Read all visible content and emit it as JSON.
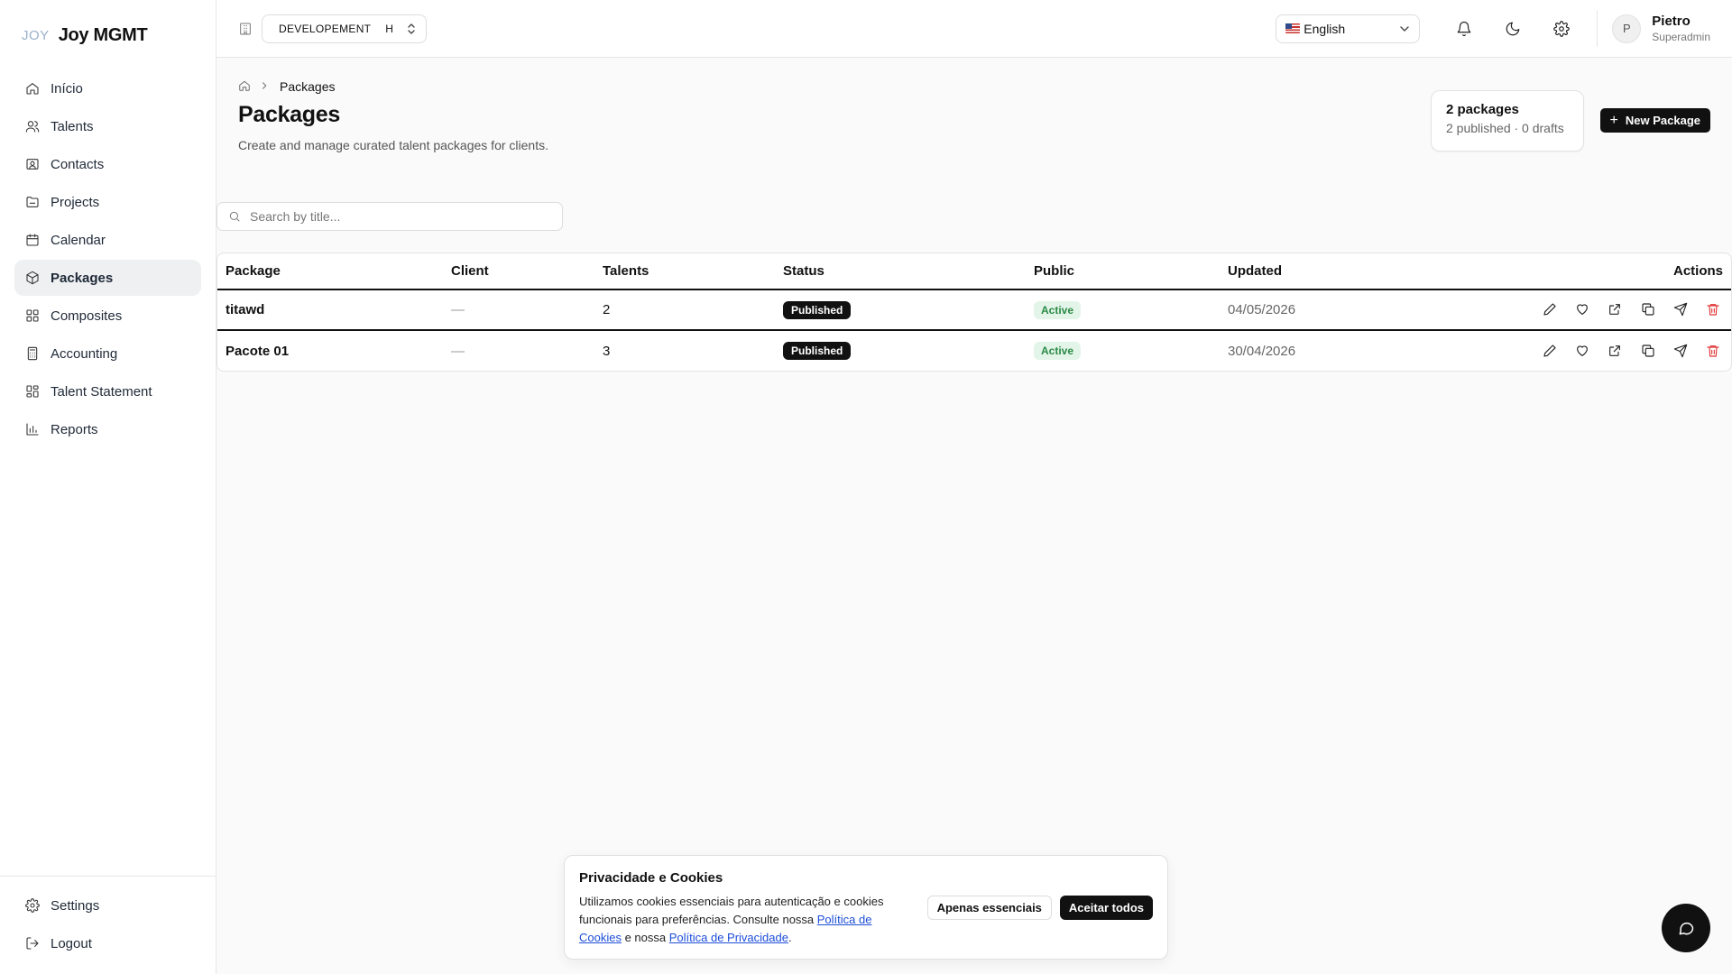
{
  "brand": {
    "mark": "JOY",
    "name": "Joy MGMT"
  },
  "sidebar": {
    "items": [
      {
        "label": "Início",
        "icon": "home-icon"
      },
      {
        "label": "Talents",
        "icon": "users-icon"
      },
      {
        "label": "Contacts",
        "icon": "contact-card-icon"
      },
      {
        "label": "Projects",
        "icon": "folder-icon"
      },
      {
        "label": "Calendar",
        "icon": "calendar-icon"
      },
      {
        "label": "Packages",
        "icon": "package-icon",
        "active": true
      },
      {
        "label": "Composites",
        "icon": "grid-icon"
      },
      {
        "label": "Accounting",
        "icon": "calculator-icon"
      },
      {
        "label": "Talent Statement",
        "icon": "layout-icon"
      },
      {
        "label": "Reports",
        "icon": "bar-chart-icon"
      }
    ],
    "bottom": [
      {
        "label": "Settings",
        "icon": "gear-icon"
      },
      {
        "label": "Logout",
        "icon": "logout-icon"
      }
    ]
  },
  "topbar": {
    "environment": "DEVELOPEMENT",
    "environment_short": "H",
    "language": "English",
    "user": {
      "initial": "P",
      "name": "Pietro",
      "role": "Superadmin"
    }
  },
  "breadcrumb": {
    "current": "Packages"
  },
  "page": {
    "title": "Packages",
    "subtitle": "Create and manage curated talent packages for clients.",
    "summary_title": "2 packages",
    "summary_sub": "2 published · 0 drafts",
    "new_button": "New Package",
    "search_placeholder": "Search by title..."
  },
  "table": {
    "headers": [
      "Package",
      "Client",
      "Talents",
      "Status",
      "Public",
      "Updated",
      "Actions"
    ],
    "rows": [
      {
        "package": "titawd",
        "client": "—",
        "talents": "2",
        "status": "Published",
        "public": "Active",
        "updated": "04/05/2026"
      },
      {
        "package": "Pacote 01",
        "client": "—",
        "talents": "3",
        "status": "Published",
        "public": "Active",
        "updated": "30/04/2026"
      }
    ]
  },
  "cookie": {
    "title": "Privacidade e Cookies",
    "text_1": "Utilizamos cookies essenciais para autenticação e cookies funcionais para preferências. Consulte nossa ",
    "link_cookies": "Política de Cookies",
    "text_2": " e nossa ",
    "link_privacy": "Política de Privacidade",
    "text_3": ".",
    "btn_essential": "Apenas essenciais",
    "btn_accept": "Aceitar todos"
  },
  "colors": {
    "accent": "#111111",
    "active_green": "#2a8a47",
    "danger": "#e03131",
    "link": "#1d4ed8"
  }
}
